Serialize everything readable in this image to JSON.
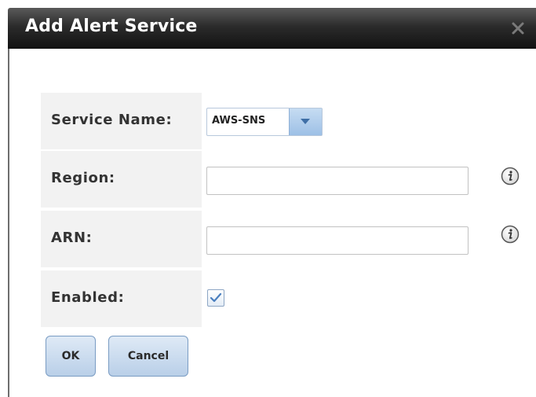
{
  "dialog": {
    "title": "Add Alert Service",
    "close_icon": "close-icon"
  },
  "form": {
    "service_name": {
      "label": "Service Name:",
      "selected": "AWS-SNS"
    },
    "region": {
      "label": "Region:",
      "value": "",
      "info_icon": "info-icon"
    },
    "arn": {
      "label": "ARN:",
      "value": "",
      "info_icon": "info-icon"
    },
    "enabled": {
      "label": "Enabled:",
      "checked": true
    }
  },
  "buttons": {
    "ok": "OK",
    "cancel": "Cancel"
  },
  "colors": {
    "titlebar": "#1f1f1f",
    "label_bg": "#f2f2f2",
    "button_accent": "#b9cfe8"
  }
}
